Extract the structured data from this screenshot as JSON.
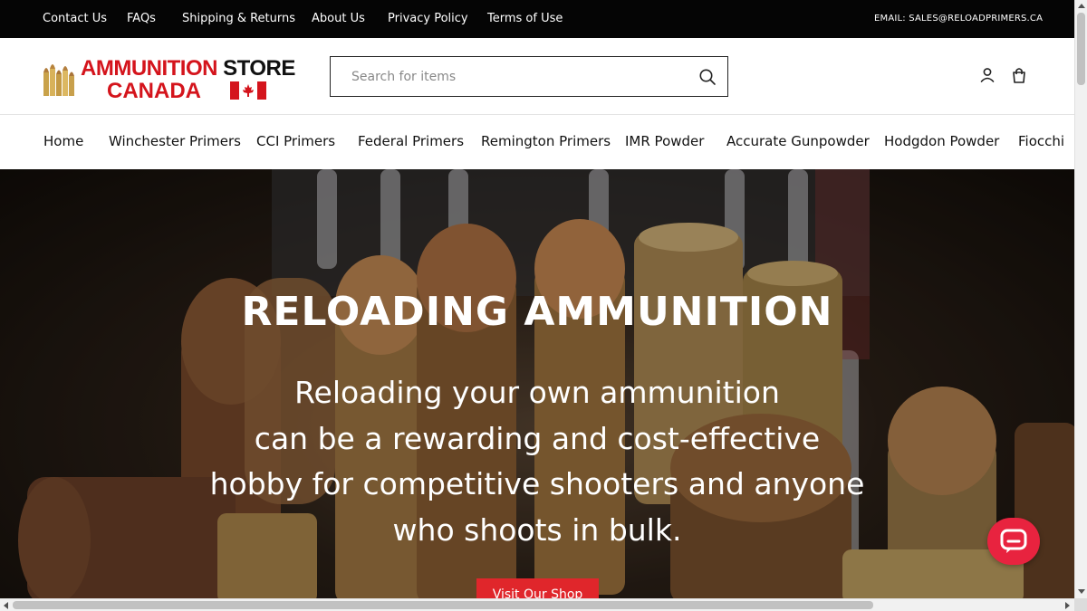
{
  "topbar": {
    "links": [
      "Contact Us",
      "FAQs",
      "Shipping & Returns",
      "About Us",
      "Privacy Policy",
      "Terms of Use"
    ],
    "email": "EMAIL: SALES@RELOADPRIMERS.CA"
  },
  "logo": {
    "line1_red": "AMMUNITION ",
    "line1_black": "STORE",
    "line2": "CANADA"
  },
  "search": {
    "placeholder": "Search for items"
  },
  "nav": {
    "items": [
      "Home",
      "Winchester Primers",
      "CCI Primers",
      "Federal Primers",
      "Remington Primers",
      "IMR Powder",
      "Accurate Gunpowder",
      "Hodgdon Powder",
      "Fiocchi"
    ]
  },
  "hero": {
    "title": "RELOADING AMMUNITION",
    "subtitle_lines": [
      "Reloading your own ammunition",
      "can be a rewarding and cost-effective",
      "hobby for competitive shooters and anyone",
      "who shoots in bulk."
    ],
    "cta_label": "Visit Our Shop"
  },
  "colors": {
    "topbar_bg": "#050505",
    "brand_red": "#d4141c",
    "cta_red": "#e0262b",
    "chat_red": "#e8233f"
  },
  "icons": {
    "search": "search-icon",
    "account": "user-icon",
    "cart": "shopping-bag-icon",
    "chat": "chat-bubble-icon"
  }
}
